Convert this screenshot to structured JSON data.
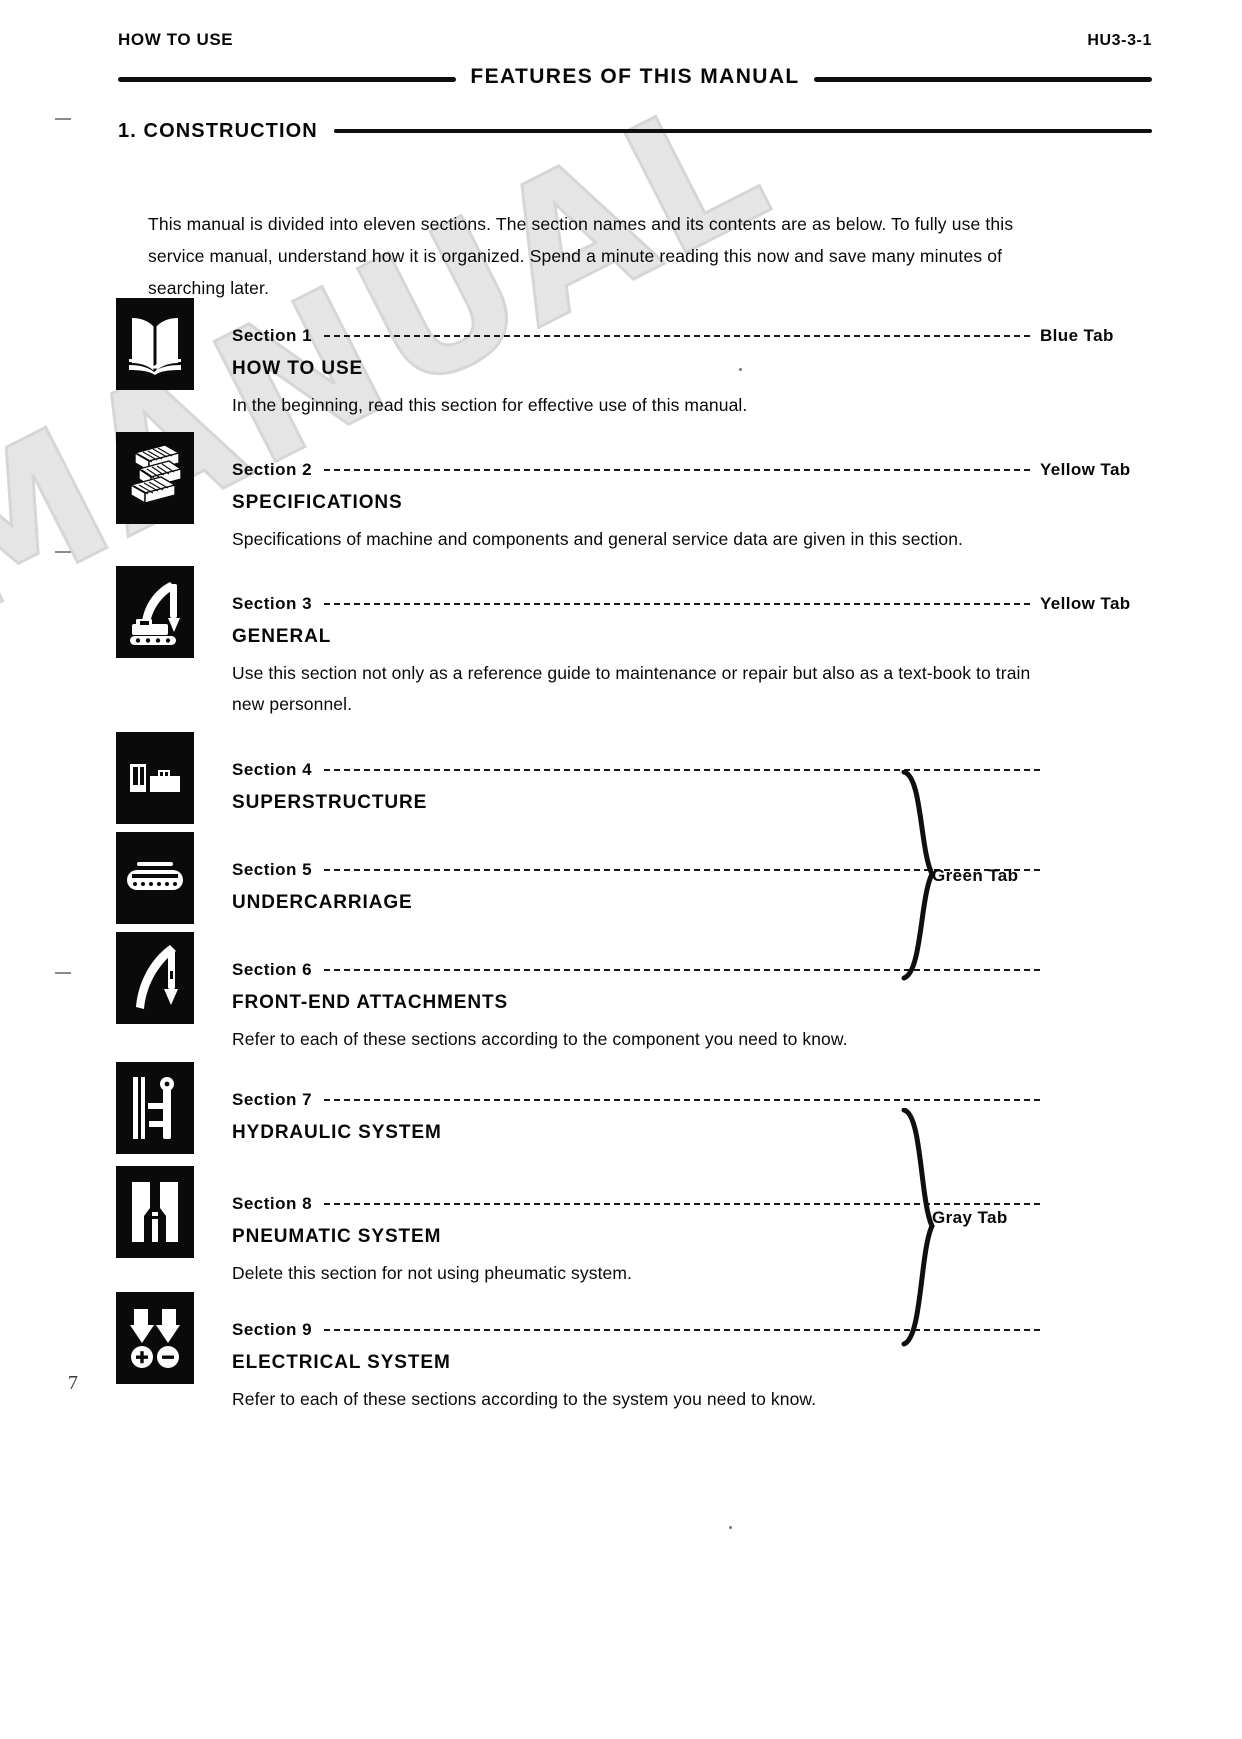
{
  "header": {
    "left": "HOW TO USE",
    "right": "HU3-3-1",
    "title": "FEATURES OF THIS MANUAL"
  },
  "section_heading": "1.  CONSTRUCTION",
  "intro": "This manual is divided into eleven sections. The section names and its contents are as below. To fully use this service manual, understand how it is organized. Spend a minute reading this now and save many minutes of searching later.",
  "entries": [
    {
      "label": "Section  1",
      "title": "HOW TO USE",
      "desc": "In the beginning, read this section for effective use of this manual.",
      "tab": "Blue Tab",
      "icon": "open-book-icon"
    },
    {
      "label": "Section  2",
      "title": "SPECIFICATIONS",
      "desc": "Specifications of machine and components and general service data are given in this section.",
      "tab": "Yellow Tab",
      "icon": "spec-sheets-icon"
    },
    {
      "label": "Section  3",
      "title": "GENERAL",
      "desc": "Use this section not only as a reference guide to maintenance or repair but also as a text-book to train new personnel.",
      "tab": "Yellow Tab",
      "icon": "excavator-icon"
    },
    {
      "label": "Section  4",
      "title": "SUPERSTRUCTURE",
      "desc": "",
      "tab": "",
      "icon": "cab-superstructure-icon"
    },
    {
      "label": "Section  5",
      "title": "UNDERCARRIAGE",
      "desc": "",
      "tab": "",
      "icon": "track-undercarriage-icon"
    },
    {
      "label": "Section  6",
      "title": "FRONT-END  ATTACHMENTS",
      "desc": "Refer to each of these sections according to the component you need to know.",
      "tab": "",
      "icon": "boom-arm-icon"
    },
    {
      "label": "Section  7",
      "title": "HYDRAULIC SYSTEM",
      "desc": "",
      "tab": "",
      "icon": "hydraulic-cylinder-icon"
    },
    {
      "label": "Section  8",
      "title": "PNEUMATIC SYSTEM",
      "desc": "Delete this section for not using pheumatic system.",
      "tab": "",
      "icon": "pneumatic-valve-icon"
    },
    {
      "label": "Section  9",
      "title": "ELECTRICAL  SYSTEM",
      "desc": "Refer to each of these sections according to the system you need to know.",
      "tab": "",
      "icon": "electrical-battery-icon"
    }
  ],
  "braces": [
    {
      "label": "Green Tab"
    },
    {
      "label": "Gray Tab"
    }
  ],
  "watermark": "MANUAL",
  "page_number": "7"
}
